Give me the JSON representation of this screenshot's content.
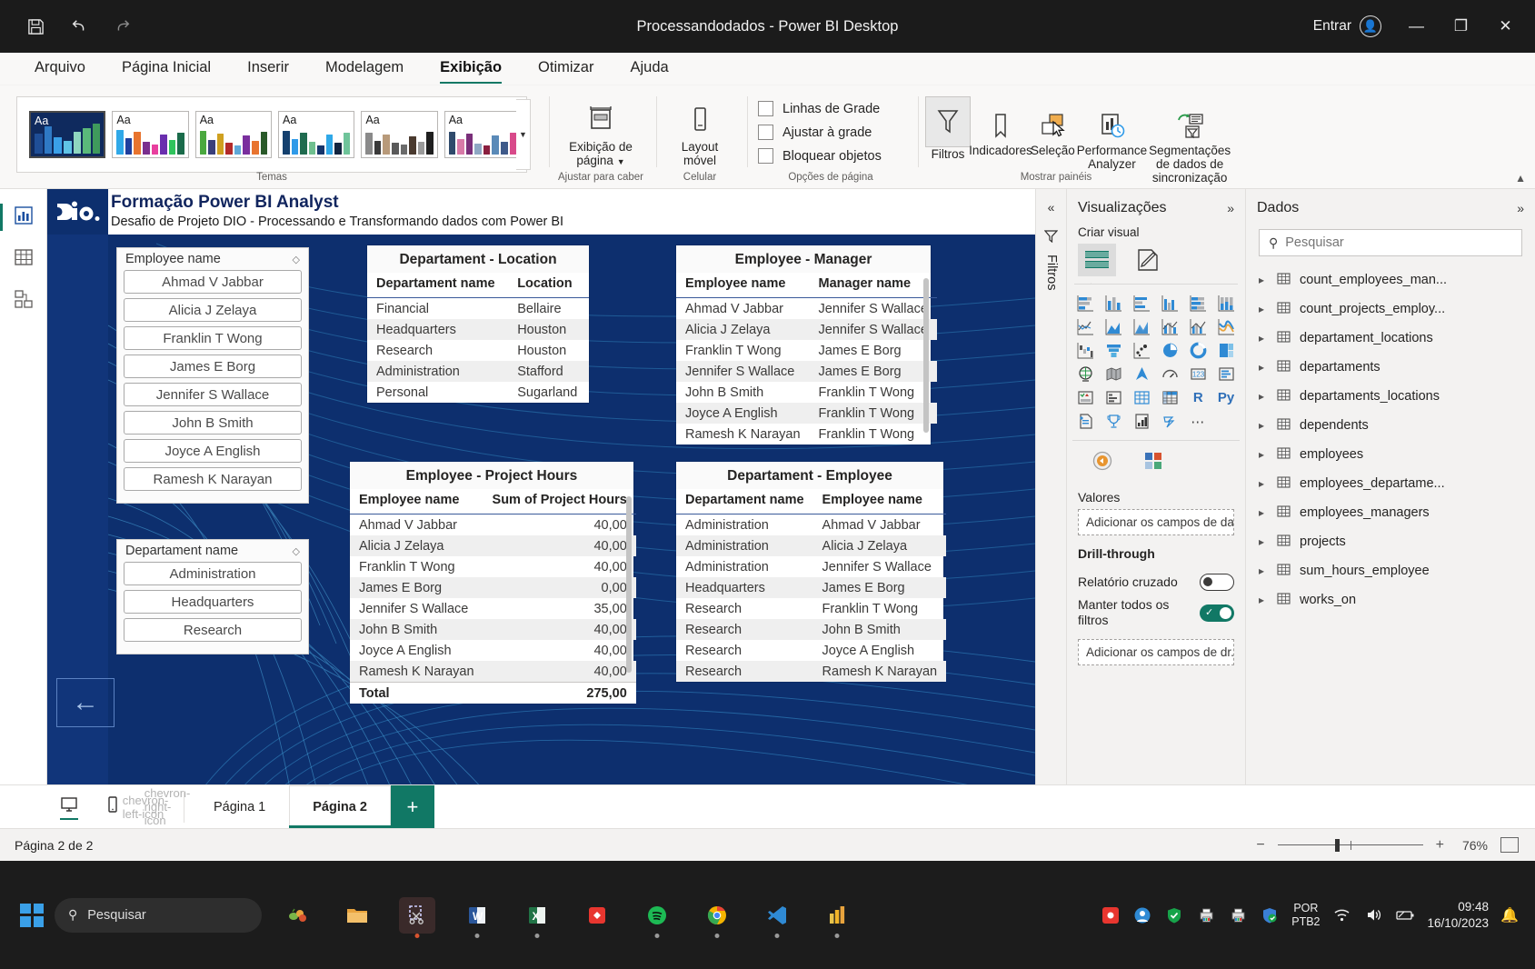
{
  "titlebar": {
    "save_icon": "save-icon",
    "undo_icon": "undo-icon",
    "redo_icon": "redo-icon",
    "title": "Processandodados - Power BI Desktop",
    "signin_label": "Entrar",
    "minimize": "—",
    "maximize": "❐",
    "close": "✕"
  },
  "menu": [
    {
      "label": "Arquivo",
      "active": false
    },
    {
      "label": "Página Inicial",
      "active": false
    },
    {
      "label": "Inserir",
      "active": false
    },
    {
      "label": "Modelagem",
      "active": false
    },
    {
      "label": "Exibição",
      "active": true
    },
    {
      "label": "Otimizar",
      "active": false
    },
    {
      "label": "Ajuda",
      "active": false
    }
  ],
  "ribbon": {
    "themes_group_label": "Temas",
    "themes": [
      {
        "name": "tema-padrao",
        "selected": true,
        "colors": [
          "#1f4e96",
          "#2f79c4",
          "#3aa0e8",
          "#5fc3e6",
          "#8fd7bf",
          "#5ab97a",
          "#3f9a5c",
          "#2f7d49"
        ]
      },
      {
        "name": "tema-2",
        "selected": false,
        "colors": [
          "#2fa8e8",
          "#1f3f9e",
          "#e8742f",
          "#7a2f8e",
          "#e83f9e",
          "#6a2fae",
          "#2fc45c",
          "#1a6b4a"
        ]
      },
      {
        "name": "tema-3",
        "selected": false,
        "colors": [
          "#4aa83f",
          "#3a3f7a",
          "#cfa020",
          "#b32a2a",
          "#5fa8d8",
          "#7a2f9e",
          "#e8742f",
          "#2a5a2a"
        ]
      },
      {
        "name": "tema-4",
        "selected": false,
        "colors": [
          "#14406e",
          "#2f9ae8",
          "#1f6b4f",
          "#6fbf8f",
          "#16356b",
          "#2fa8e8",
          "#12243f",
          "#6fc49a"
        ]
      },
      {
        "name": "tema-5",
        "selected": false,
        "colors": [
          "#8a8a8a",
          "#3a3a3a",
          "#b89a7a",
          "#5a5a5a",
          "#6b6b6b",
          "#4a3a2f",
          "#9a9a9a",
          "#1f1f1f"
        ]
      },
      {
        "name": "tema-6",
        "selected": false,
        "colors": [
          "#2f4a6b",
          "#d87aa8",
          "#7a2f7a",
          "#8fa8c4",
          "#8a1f3f",
          "#5a8ab8",
          "#3f5a8a",
          "#d84a8a"
        ]
      }
    ],
    "page_display": {
      "label_line1": "Exibição de",
      "label_line2": "página",
      "icon": "page-view-icon",
      "group_label": "Ajustar para caber"
    },
    "mobile_layout": {
      "label_line1": "Layout",
      "label_line2": "móvel",
      "icon": "mobile-layout-icon",
      "group_label": "Celular"
    },
    "page_options": {
      "group_label": "Opções de página",
      "checkboxes": [
        {
          "label": "Linhas de Grade",
          "checked": false
        },
        {
          "label": "Ajustar à grade",
          "checked": false
        },
        {
          "label": "Bloquear objetos",
          "checked": false
        }
      ]
    },
    "panes": {
      "group_label": "Mostrar painéis",
      "items": [
        {
          "label": "Filtros",
          "icon": "funnel-icon",
          "active": true
        },
        {
          "label": "Indicadores",
          "icon": "bookmark-icon",
          "active": false
        },
        {
          "label": "Seleção",
          "icon": "selection-icon",
          "active": false
        },
        {
          "label": "Performance Analyzer",
          "icon": "performance-analyzer-icon",
          "active": false
        },
        {
          "label": "Segmentações de dados de sincronização",
          "icon": "sync-slicers-icon",
          "active": false
        }
      ]
    },
    "collapse_icon": "chevron-up-icon"
  },
  "left_rail": [
    {
      "name": "report-view",
      "icon": "report-chart-icon",
      "active": true
    },
    {
      "name": "table-view",
      "icon": "table-grid-icon",
      "active": false
    },
    {
      "name": "model-view",
      "icon": "model-relationship-icon",
      "active": false
    }
  ],
  "report": {
    "title": "Formação Power BI Analyst",
    "subtitle": "Desafio de Projeto DIO - Processando e Transformando dados com Power BI",
    "logo_text": "dio.",
    "back_button_icon": "arrow-left-icon",
    "slicers": [
      {
        "name": "employee-name-slicer",
        "header": "Employee name",
        "eraser_icon": "eraser-icon",
        "items": [
          "Ahmad V Jabbar",
          "Alicia J Zelaya",
          "Franklin T Wong",
          "James E Borg",
          "Jennifer S Wallace",
          "John B Smith",
          "Joyce A English",
          "Ramesh K Narayan"
        ]
      },
      {
        "name": "departament-name-slicer",
        "header": "Departament name",
        "eraser_icon": "eraser-icon",
        "items": [
          "Administration",
          "Headquarters",
          "Research"
        ]
      }
    ],
    "tables": [
      {
        "name": "departament-location-table",
        "title": "Departament - Location",
        "columns": [
          "Departament name",
          "Location"
        ],
        "align": [
          "left",
          "left"
        ],
        "rows": [
          [
            "Financial",
            "Bellaire"
          ],
          [
            "Headquarters",
            "Houston"
          ],
          [
            "Research",
            "Houston"
          ],
          [
            "Administration",
            "Stafford"
          ],
          [
            "Personal",
            "Sugarland"
          ]
        ]
      },
      {
        "name": "employee-manager-table",
        "title": "Employee - Manager",
        "columns": [
          "Employee name",
          "Manager name"
        ],
        "align": [
          "left",
          "left"
        ],
        "rows": [
          [
            "Ahmad V Jabbar",
            "Jennifer S Wallace"
          ],
          [
            "Alicia J Zelaya",
            "Jennifer S Wallace"
          ],
          [
            "Franklin T Wong",
            "James E Borg"
          ],
          [
            "Jennifer S Wallace",
            "James E Borg"
          ],
          [
            "John B Smith",
            "Franklin T Wong"
          ],
          [
            "Joyce A English",
            "Franklin T Wong"
          ],
          [
            "Ramesh K Narayan",
            "Franklin T Wong"
          ]
        ]
      },
      {
        "name": "employee-project-hours-table",
        "title": "Employee - Project Hours",
        "columns": [
          "Employee name",
          "Sum of Project Hours"
        ],
        "align": [
          "left",
          "right"
        ],
        "rows": [
          [
            "Ahmad V Jabbar",
            "40,00"
          ],
          [
            "Alicia J Zelaya",
            "40,00"
          ],
          [
            "Franklin T Wong",
            "40,00"
          ],
          [
            "James E Borg",
            "0,00"
          ],
          [
            "Jennifer S Wallace",
            "35,00"
          ],
          [
            "John B Smith",
            "40,00"
          ],
          [
            "Joyce A English",
            "40,00"
          ],
          [
            "Ramesh K Narayan",
            "40,00"
          ]
        ],
        "total_row": [
          "Total",
          "275,00"
        ]
      },
      {
        "name": "departament-employee-table",
        "title": "Departament - Employee",
        "columns": [
          "Departament name",
          "Employee name"
        ],
        "align": [
          "left",
          "left"
        ],
        "rows": [
          [
            "Administration",
            "Ahmad V Jabbar"
          ],
          [
            "Administration",
            "Alicia J Zelaya"
          ],
          [
            "Administration",
            "Jennifer S Wallace"
          ],
          [
            "Headquarters",
            "James E Borg"
          ],
          [
            "Research",
            "Franklin T Wong"
          ],
          [
            "Research",
            "John B Smith"
          ],
          [
            "Research",
            "Joyce A English"
          ],
          [
            "Research",
            "Ramesh K Narayan"
          ]
        ]
      }
    ]
  },
  "filters_rail": {
    "collapse_icon": "double-chevron-left-icon",
    "funnel_icon": "funnel-icon",
    "label": "Filtros"
  },
  "viz_pane": {
    "title": "Visualizações",
    "expand_icon": "double-chevron-right-icon",
    "build_label": "Criar visual",
    "build_icons": [
      {
        "name": "build-fields-icon",
        "selected": true
      },
      {
        "name": "build-format-icon",
        "selected": false
      }
    ],
    "gallery": [
      "stacked-bar-chart-icon",
      "stacked-column-chart-icon",
      "clustered-bar-chart-icon",
      "clustered-column-chart-icon",
      "100-stacked-bar-chart-icon",
      "100-stacked-column-chart-icon",
      "line-chart-icon",
      "area-chart-icon",
      "stacked-area-chart-icon",
      "line-stacked-column-chart-icon",
      "line-clustered-column-chart-icon",
      "ribbon-chart-icon",
      "waterfall-chart-icon",
      "funnel-chart-icon",
      "scatter-chart-icon",
      "pie-chart-icon",
      "donut-chart-icon",
      "treemap-icon",
      "map-icon",
      "filled-map-icon",
      "azure-map-icon",
      "gauge-icon",
      "card-icon",
      "multi-row-card-icon",
      "kpi-icon",
      "slicer-icon",
      "table-icon",
      "matrix-icon",
      "r-script-visual-icon",
      "python-visual-icon",
      "paginated-report-icon",
      "key-influencers-icon",
      "decomposition-tree-icon",
      "power-automate-icon",
      "more-options-icon"
    ],
    "format_icons": [
      "format-paint-icon",
      "color-palette-icon"
    ],
    "values_label": "Valores",
    "values_placeholder": "Adicionar os campos de da...",
    "drillthrough_label": "Drill-through",
    "cross_report_label": "Relatório cruzado",
    "cross_report_on": false,
    "keep_all_filters_label": "Manter todos os filtros",
    "keep_all_filters_on": true,
    "drillthrough_placeholder": "Adicionar os campos de dr..."
  },
  "data_pane": {
    "title": "Dados",
    "expand_icon": "double-chevron-right-icon",
    "search_placeholder": "Pesquisar",
    "search_icon": "search-icon",
    "tables": [
      "count_employees_man...",
      "count_projects_employ...",
      "departament_locations",
      "departaments",
      "departaments_locations",
      "dependents",
      "employees",
      "employees_departame...",
      "employees_managers",
      "projects",
      "sum_hours_employee",
      "works_on"
    ]
  },
  "page_bar": {
    "desktop_icon": "desktop-view-icon",
    "phone_icon": "phone-view-icon",
    "prev_icon": "chevron-left-icon",
    "next_icon": "chevron-right-icon",
    "tabs": [
      {
        "label": "Página 1",
        "active": false
      },
      {
        "label": "Página 2",
        "active": true
      }
    ],
    "add_label": "+"
  },
  "status_bar": {
    "page_info": "Página 2 de 2",
    "zoom_out": "−",
    "zoom_in": "+",
    "zoom_level": "76%",
    "fit_icon": "fit-to-page-icon"
  },
  "taskbar": {
    "start_icon": "windows-start-icon",
    "search_placeholder": "Pesquisar",
    "search_icon": "search-icon",
    "apps": [
      {
        "name": "weather-widget-icon",
        "glyph": "🌶",
        "bg": "none",
        "running": false
      },
      {
        "name": "file-explorer-icon",
        "glyph": "📁",
        "bg": "none",
        "running": false
      },
      {
        "name": "snipping-tool-icon",
        "glyph": "✂",
        "bg": "#3a2a2a",
        "running": true
      },
      {
        "name": "word-icon",
        "glyph": "W",
        "bg": "none",
        "running": true
      },
      {
        "name": "excel-icon",
        "glyph": "X",
        "bg": "none",
        "running": true
      },
      {
        "name": "adobe-icon",
        "glyph": "◆",
        "bg": "none",
        "running": false
      },
      {
        "name": "spotify-icon",
        "glyph": "♫",
        "bg": "none",
        "running": true
      },
      {
        "name": "chrome-icon",
        "glyph": "●",
        "bg": "none",
        "running": true
      },
      {
        "name": "vscode-icon",
        "glyph": "✖",
        "bg": "none",
        "running": true
      },
      {
        "name": "power-bi-icon",
        "glyph": "▐",
        "bg": "none",
        "running": true
      }
    ],
    "tray": [
      {
        "name": "tray-red-icon"
      },
      {
        "name": "tray-blue-icon"
      },
      {
        "name": "tray-shield-green-icon"
      },
      {
        "name": "tray-printer-icon"
      },
      {
        "name": "tray-printer2-icon"
      },
      {
        "name": "tray-defender-icon"
      }
    ],
    "language_line1": "POR",
    "language_line2": "PTB2",
    "wifi_icon": "wifi-icon",
    "volume_icon": "volume-icon",
    "battery_icon": "battery-icon",
    "time": "09:48",
    "date": "16/10/2023",
    "notification_icon": "bell-icon"
  }
}
